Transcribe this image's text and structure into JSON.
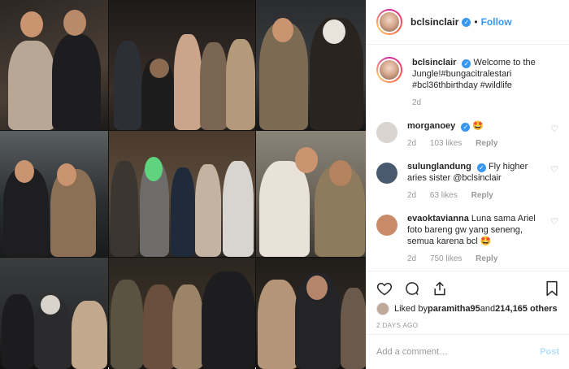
{
  "post": {
    "username": "bclsinclair",
    "follow_label": "Follow",
    "dot": "•",
    "verified_glyph": "✓"
  },
  "caption": {
    "username": "bclsinclair",
    "text": "Welcome to the Jungle!#bungacitralestari #bcl36thbirthday #wildlife",
    "time": "2d"
  },
  "comments": [
    {
      "username": "morganoey",
      "text": "🤩",
      "time": "2d",
      "likes": "103 likes",
      "reply": "Reply",
      "avatar_color": "#d9d4cf"
    },
    {
      "username": "sulunglandung",
      "text": "Fly higher aries sister @bclsinclair",
      "time": "2d",
      "likes": "63 likes",
      "reply": "Reply",
      "avatar_color": "#4a5a6e"
    },
    {
      "username": "evaoktavianna",
      "text": "Luna sama Ariel foto bareng gw yang seneng, semua karena bcl 🤩",
      "time": "2d",
      "likes": "750 likes",
      "reply": "Reply",
      "avatar_color": "#c98a6a"
    }
  ],
  "actions": {
    "icons": [
      "heart-icon",
      "comment-icon",
      "share-icon",
      "bookmark-icon"
    ]
  },
  "likes_line": {
    "prefix": "Liked by ",
    "first_user": "paramitha95",
    "middle": " and ",
    "others": "214,165 others"
  },
  "timestamp": "2 DAYS AGO",
  "comment_input": {
    "placeholder": "Add a comment…"
  },
  "post_button": "Post",
  "colors": {
    "accent": "#3897f0",
    "post_disabled": "#b2dffc",
    "meta": "#999999"
  }
}
